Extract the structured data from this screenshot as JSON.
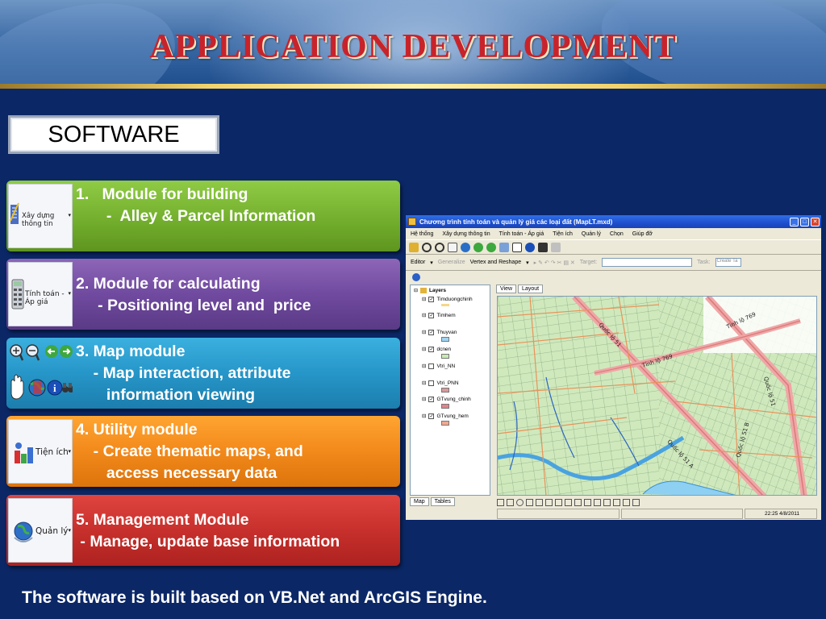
{
  "header": {
    "title": "APPLICATION DEVELOPMENT"
  },
  "section_label": "SOFTWARE",
  "modules": [
    {
      "icon_label": "Xây dựng thông tin",
      "lines": [
        "1.   Module for building",
        "       -  Alley & Parcel Information"
      ],
      "color": "#76b22f"
    },
    {
      "icon_label": "Tính toán - Áp giá",
      "lines": [
        "2. Module for calculating",
        "     - Positioning level and  price"
      ],
      "color": "#704a9f"
    },
    {
      "icon_label": "",
      "lines": [
        "3. Map module",
        "    - Map interaction, attribute",
        "       information viewing"
      ],
      "color": "#2696c8"
    },
    {
      "icon_label": "Tiện ích",
      "lines": [
        "4. Utility module",
        "    - Create thematic maps, and",
        "       access necessary data"
      ],
      "color": "#f2891b"
    },
    {
      "icon_label": "Quản lý",
      "lines": [
        "5. Management Module",
        " - Manage, update base information"
      ],
      "color": "#c7302c"
    }
  ],
  "footer": "The software is built based on VB.Net and ArcGIS Engine.",
  "app": {
    "title": "Chương trình  tính toán và quản lý giá các loại đất  (MapLT.mxd)",
    "menu": [
      "Hệ thống",
      "Xây dựng thông tin",
      "Tính toán - Áp giá",
      "Tiện ích",
      "Quản lý",
      "Chọn",
      "Giúp đỡ"
    ],
    "editor": {
      "editor_label": "Editor",
      "generalize": "Generalize",
      "task_mode": "Vertex and Reshape",
      "target_label": "Target:",
      "task_label": "Task:",
      "task_value": "Create Ta"
    },
    "toc_root": "Layers",
    "layers": [
      {
        "name": "Timduongchinh",
        "checked": true,
        "swatch": "#f5d78a"
      },
      {
        "name": "Timhem",
        "checked": true,
        "swatch": ""
      },
      {
        "name": "Thuyvan",
        "checked": true,
        "swatch": "#9fd3f2"
      },
      {
        "name": "dcnen",
        "checked": true,
        "swatch": "#c8ecb0"
      },
      {
        "name": "Vtri_NN",
        "checked": false,
        "swatch": ""
      },
      {
        "name": "Vtri_PNN",
        "checked": false,
        "swatch": "#d99a9a"
      },
      {
        "name": "GTvung_chinh",
        "checked": true,
        "swatch": "#e3838b"
      },
      {
        "name": "GTvung_hem",
        "checked": true,
        "swatch": "#f0a890"
      }
    ],
    "toc_tabs": [
      "Map",
      "Tables"
    ],
    "view_tabs": [
      "View",
      "Layout"
    ],
    "map_labels": [
      "Tỉnh lộ 769",
      "Tỉnh lộ 769",
      "Quốc lộ 51",
      "Quốc lộ 51 A",
      "Quốc lộ 51 B",
      "Quốc lộ 51"
    ],
    "status_time": "22:25 4/8/2011"
  }
}
